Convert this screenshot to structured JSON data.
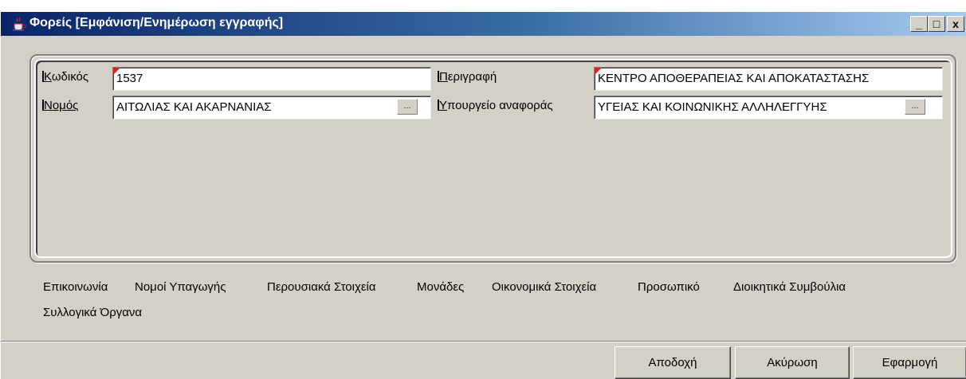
{
  "window": {
    "title": "Φορείς [Εμφάνιση/Ενημέρωση  εγγραφής]",
    "minimize_label": "_",
    "maximize_label": "□",
    "close_label": "x"
  },
  "form": {
    "code": {
      "label_mnemonic": "Κ",
      "label_rest": "ωδικός",
      "value": "1537"
    },
    "description": {
      "label_mnemonic": "Π",
      "label_rest": "εριγραφή",
      "value": "ΚΕΝΤΡΟ ΑΠΟΘΕΡΑΠΕΙΑΣ ΚΑΙ ΑΠΟΚΑΤΑΣΤΑΣΗΣ"
    },
    "prefecture": {
      "label_mnemonic": "Ν",
      "label_rest": "ομός",
      "value": "ΑΙΤΩΛΙΑΣ ΚΑΙ ΑΚΑΡΝΑΝΙΑΣ",
      "lookup_label": "..."
    },
    "ministry": {
      "label_mnemonic": "Υ",
      "label_rest": "πουργείο αναφοράς",
      "value": "ΥΓΕΙΑΣ ΚΑΙ ΚΟΙΝΩΝΙΚΗΣ ΑΛΛΗΛΕΓΓΥΗΣ",
      "lookup_label": "..."
    }
  },
  "tabs": [
    "Επικοινωνία",
    "Νομοί Υπαγωγής",
    "Περουσιακά Στοιχεία",
    "Μονάδες",
    "Οικονομικά Στοιχεία",
    "Προσωπικό",
    "Διοικητικά Συμβούλια",
    "Συλλογικά Όργανα"
  ],
  "buttons": {
    "accept": "Αποδοχή",
    "cancel": "Ακύρωση",
    "apply": "Εφαρμογή"
  },
  "colors": {
    "title_start": "#0a246a",
    "title_end": "#a6caf0",
    "window_bg": "#d4d0c8",
    "required_marker": "#e02020"
  },
  "icons": {
    "title": "java-coffee-cup-icon",
    "required": "required-field-marker"
  }
}
